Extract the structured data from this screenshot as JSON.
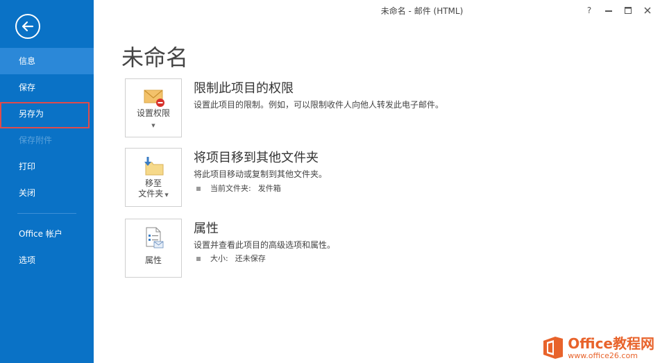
{
  "window": {
    "title": "未命名 - 邮件 (HTML)",
    "help": "?",
    "minimize": "—",
    "maximize": "☐",
    "close": "✕"
  },
  "sidebar": {
    "items": [
      {
        "label": "信息"
      },
      {
        "label": "保存"
      },
      {
        "label": "另存为"
      },
      {
        "label": "保存附件"
      },
      {
        "label": "打印"
      },
      {
        "label": "关闭"
      },
      {
        "label": "Office 帐户"
      },
      {
        "label": "选项"
      }
    ]
  },
  "main": {
    "title": "未命名",
    "sections": [
      {
        "tile_label": "设置权限",
        "title": "限制此项目的权限",
        "desc": "设置此项目的限制。例如，可以限制收件人向他人转发此电子邮件。"
      },
      {
        "tile_label_line1": "移至",
        "tile_label_line2": "文件夹",
        "title": "将项目移到其他文件夹",
        "desc": "将此项目移动或复制到其他文件夹。",
        "meta_label": "当前文件夹:",
        "meta_value": "发件箱"
      },
      {
        "tile_label": "属性",
        "title": "属性",
        "desc": "设置并查看此项目的高级选项和属性。",
        "meta_label": "大小:",
        "meta_value": "还未保存"
      }
    ]
  },
  "watermark": {
    "brand": "Office教程网",
    "url": "www.office26.com"
  },
  "colors": {
    "sidebar": "#0a72c6",
    "active": "#2b88d8",
    "highlight_border": "#e04b4b",
    "watermark": "#e8632b"
  }
}
